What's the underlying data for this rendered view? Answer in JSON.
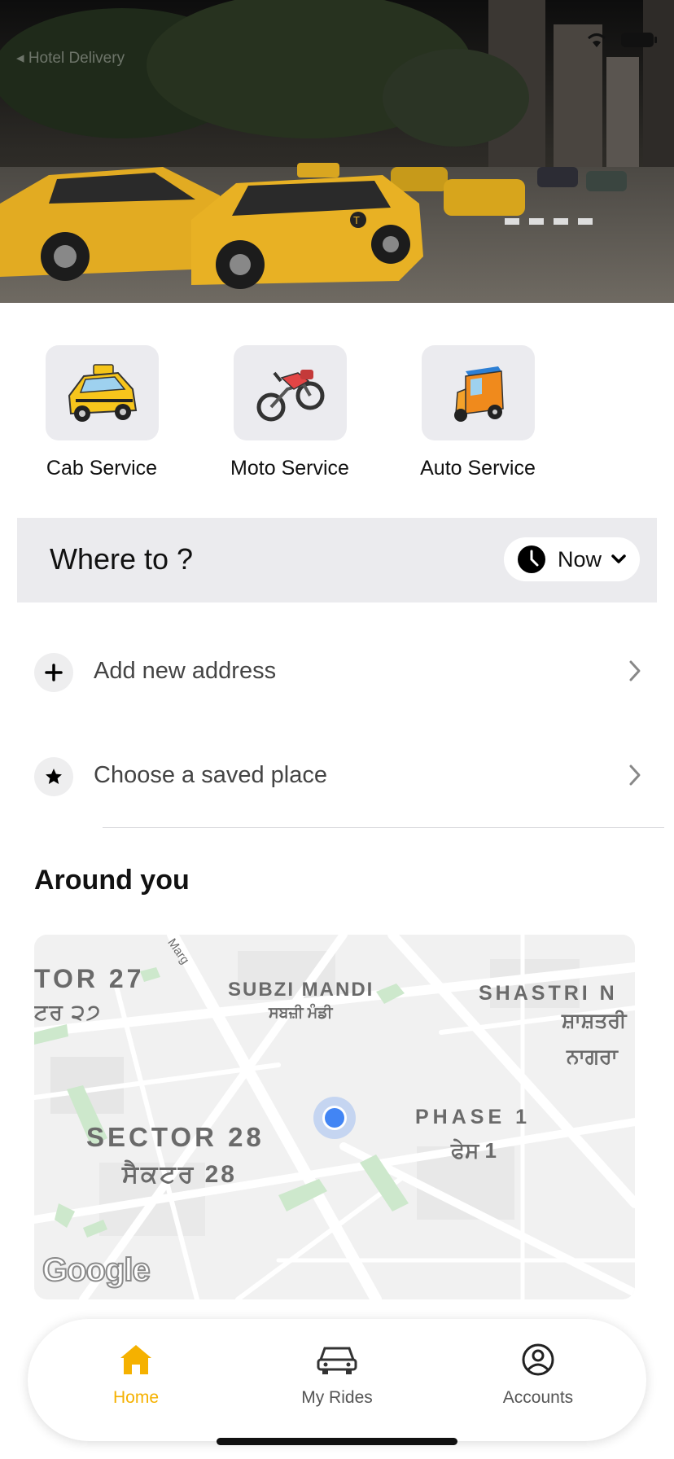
{
  "status_bar": {
    "back_app": "◂ Hotel Delivery"
  },
  "services": [
    {
      "label": "Cab Service",
      "icon": "taxi-car-icon"
    },
    {
      "label": "Moto Service",
      "icon": "motorbike-icon"
    },
    {
      "label": "Auto Service",
      "icon": "auto-rickshaw-icon"
    }
  ],
  "where": {
    "title": "Where to ?",
    "time_label": "Now"
  },
  "rows": [
    {
      "label": "Add new address",
      "icon": "plus-icon"
    },
    {
      "label": "Choose a saved place",
      "icon": "star-icon"
    }
  ],
  "around_title": "Around you",
  "map": {
    "labels": {
      "marg": "Marg",
      "tor27": "TOR 27",
      "tor27_pa": "ਟਰ ੨੭",
      "subzi": "SUBZI MANDI",
      "subzi_pa": "ਸਬਜ਼ੀ ਮੰਡੀ",
      "shastri": "SHASTRI N",
      "shastri_pa1": "ਸ਼ਾਸ਼ਤਰੀ",
      "shastri_pa2": "ਨਾਗਰਾ",
      "phase": "PHASE 1",
      "phase_pa": "ਫੇਸ 1",
      "sector": "SECTOR 28",
      "sector_pa": "ਸੈਕਟਰ 28"
    },
    "attribution": "Google"
  },
  "nav": [
    {
      "label": "Home",
      "icon": "home-icon",
      "active": true
    },
    {
      "label": "My Rides",
      "icon": "car-icon",
      "active": false
    },
    {
      "label": "Accounts",
      "icon": "account-icon",
      "active": false
    }
  ],
  "colors": {
    "accent": "#f5b100",
    "location_dot": "#4285f4"
  }
}
